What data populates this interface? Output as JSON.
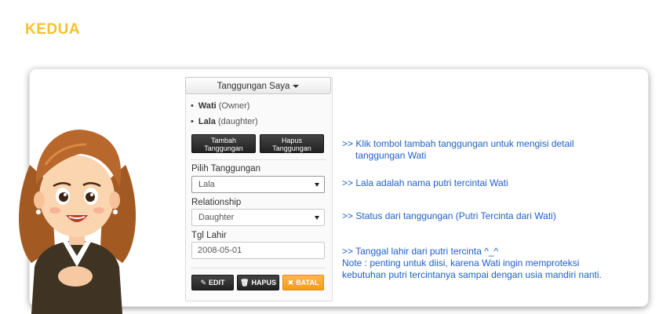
{
  "heading": "KEDUA",
  "colors": {
    "heading": "#f5c12e",
    "note_text": "#1f5fc9",
    "batal": "#f79a17",
    "dark_button": "#2b2b2b"
  },
  "dropdown": {
    "label": "Tanggungan Saya",
    "icon": "caret-down-icon"
  },
  "dependents": [
    {
      "name": "Wati",
      "role": "(Owner)"
    },
    {
      "name": "Lala",
      "role": "(daughter)"
    }
  ],
  "buttons": {
    "tambah_line1": "Tambah",
    "tambah_line2": "Tanggungan",
    "hapus_line1": "Hapus",
    "hapus_line2": "Tanggungan"
  },
  "form": {
    "pilih_label": "Pilih Tanggungan",
    "pilih_value": "Lala",
    "relationship_label": "Relationship",
    "relationship_value": "Daughter",
    "tgl_label": "Tgl Lahir",
    "tgl_value": "2008-05-01"
  },
  "actions": {
    "edit": "EDIT",
    "edit_icon": "edit-icon",
    "hapus": "HAPUS",
    "hapus_icon": "trash-icon",
    "batal": "BATAL",
    "batal_icon": "close-icon"
  },
  "notes": {
    "n1_line1": ">> Klik tombol tambah tanggungan untuk mengisi detail",
    "n1_line2": "tanggungan Wati",
    "n2": ">> Lala adalah nama putri tercintai Wati",
    "n3": ">> Status dari tanggungan (Putri Tercinta dari Wati)",
    "n4_line1": ">> Tanggal lahir dari putri tercinta ^_^",
    "n4_line2": "Note : penting untuk diisi, karena Wati ingin memproteksi",
    "n4_line3": "kebutuhan putri tercintanya sampai dengan usia mandiri nanti."
  }
}
